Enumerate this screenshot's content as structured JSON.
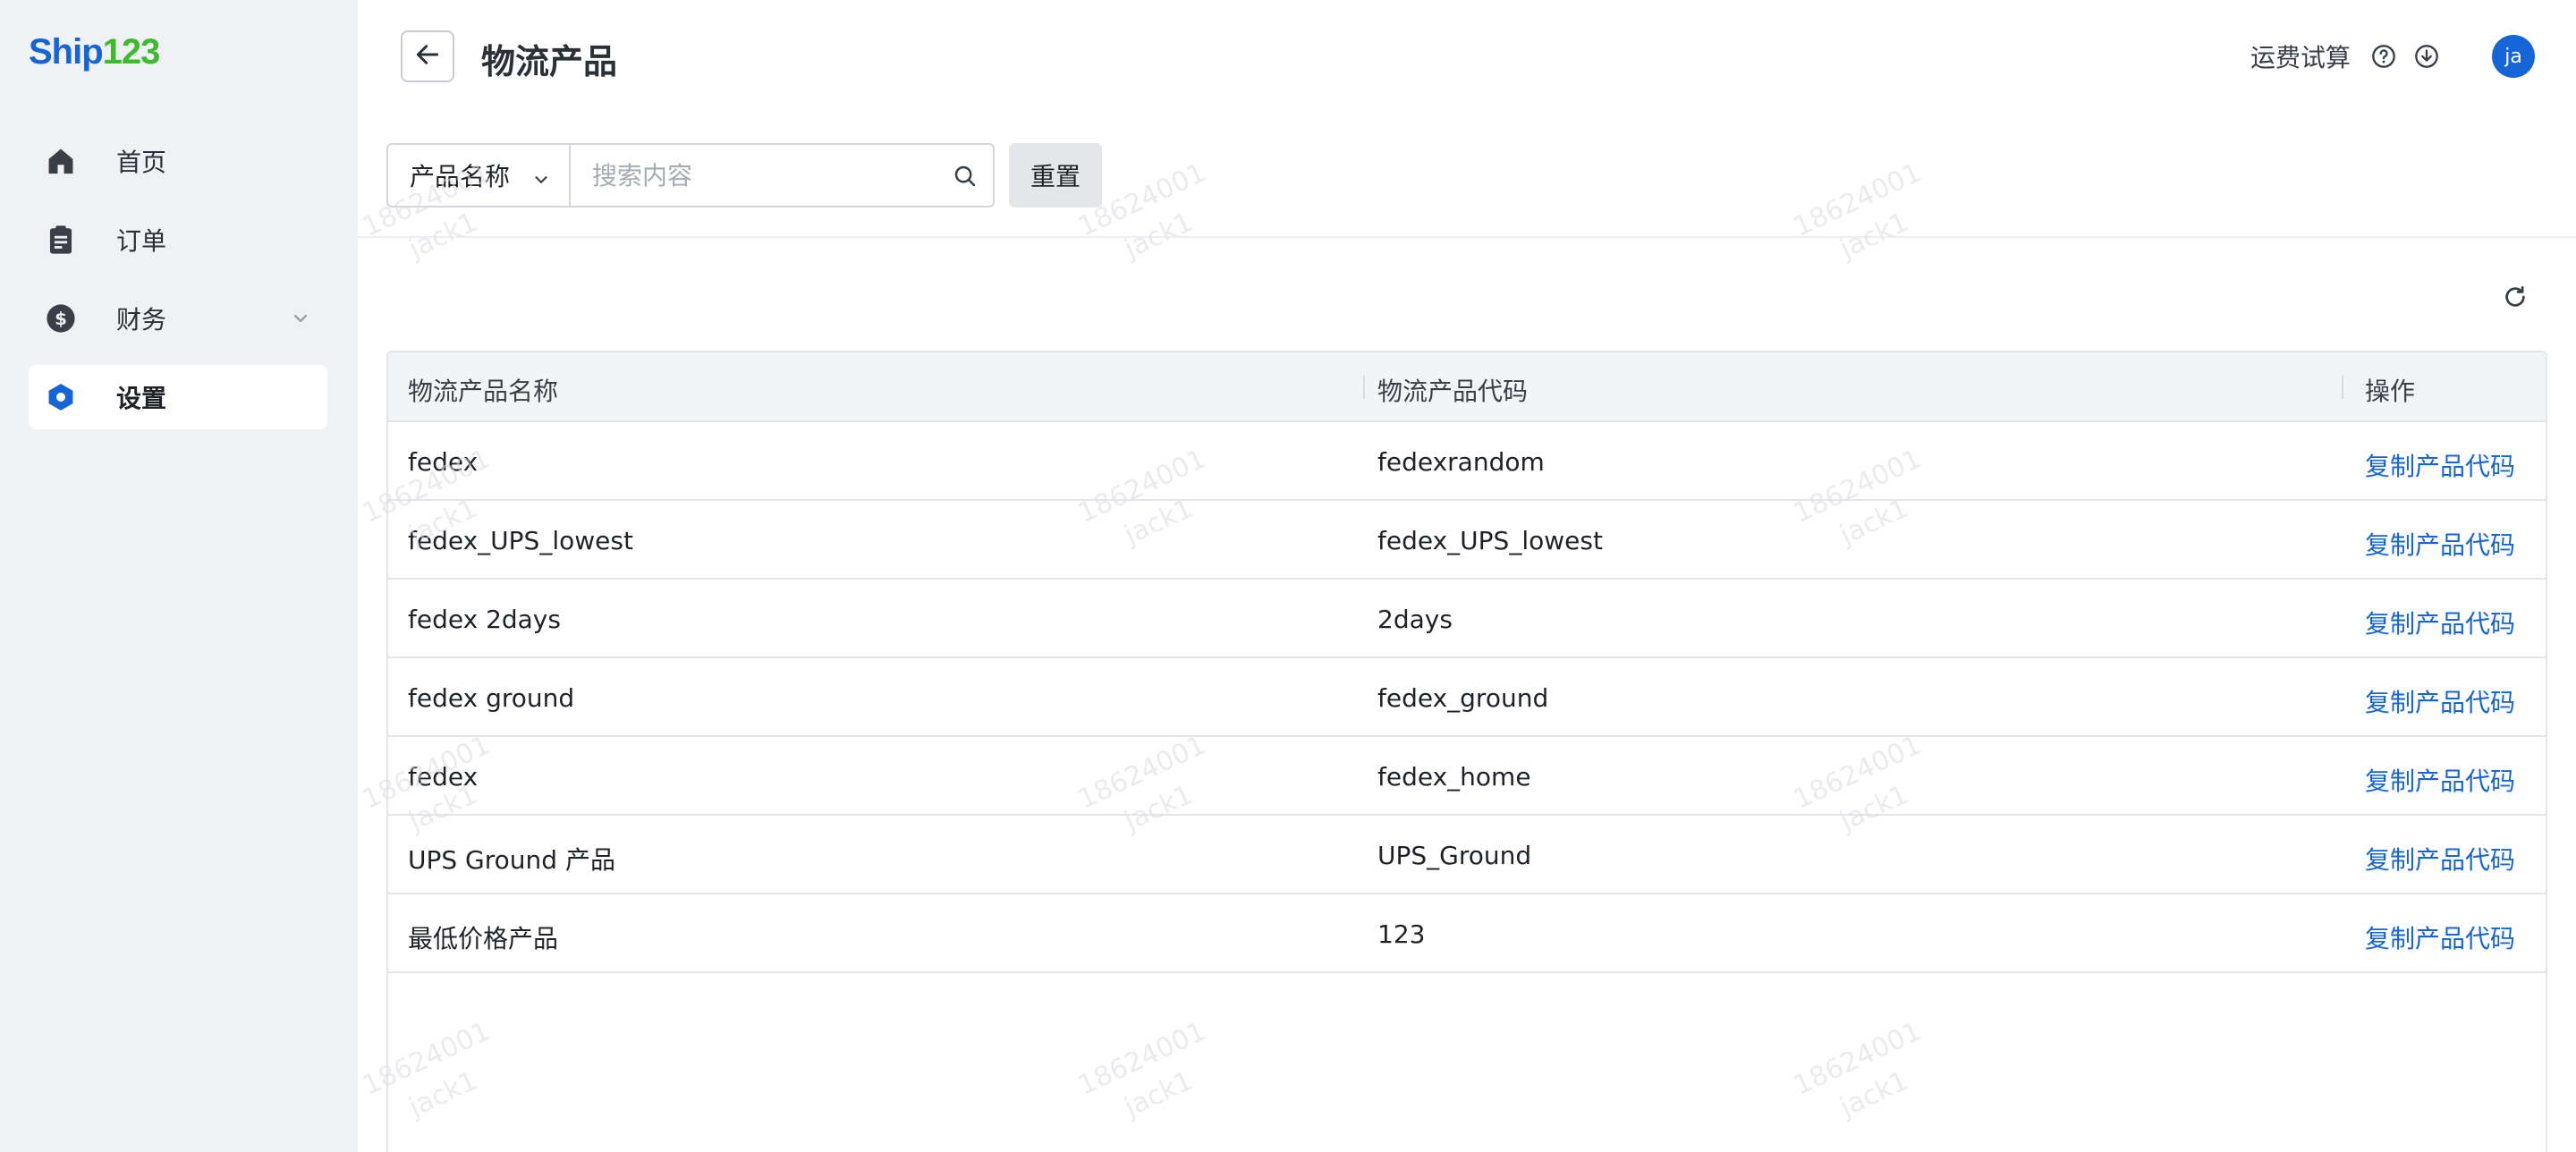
{
  "app": {
    "logo_ship": "Ship",
    "logo_num": "123"
  },
  "sidebar": {
    "items": [
      {
        "label": "首页",
        "icon": "home-icon"
      },
      {
        "label": "订单",
        "icon": "clipboard-icon"
      },
      {
        "label": "财务",
        "icon": "dollar-icon",
        "expandable": true
      },
      {
        "label": "设置",
        "icon": "settings-hexagon-icon",
        "active": true
      }
    ]
  },
  "header": {
    "title": "物流产品",
    "freight_calc": "运费试算",
    "avatar_text": "ja"
  },
  "search": {
    "field_select": "产品名称",
    "placeholder": "搜索内容",
    "reset_label": "重置"
  },
  "table": {
    "columns": [
      "物流产品名称",
      "物流产品代码",
      "操作"
    ],
    "rows": [
      {
        "name": "fedex",
        "code": "fedexrandom",
        "action": "复制产品代码"
      },
      {
        "name": "fedex_UPS_lowest",
        "code": "fedex_UPS_lowest",
        "action": "复制产品代码"
      },
      {
        "name": "fedex 2days",
        "code": "2days",
        "action": "复制产品代码"
      },
      {
        "name": "fedex ground",
        "code": "fedex_ground",
        "action": "复制产品代码"
      },
      {
        "name": "fedex",
        "code": "fedex_home",
        "action": "复制产品代码"
      },
      {
        "name": "UPS Ground 产品",
        "code": "UPS_Ground",
        "action": "复制产品代码"
      },
      {
        "name": "最低价格产品",
        "code": "123",
        "action": "复制产品代码"
      }
    ]
  },
  "watermark": {
    "line1": "18624001",
    "line2": "jack1"
  },
  "colors": {
    "brand_blue": "#1565d8",
    "brand_green": "#3dbb2c",
    "sidebar_bg": "#f0f1f4"
  }
}
